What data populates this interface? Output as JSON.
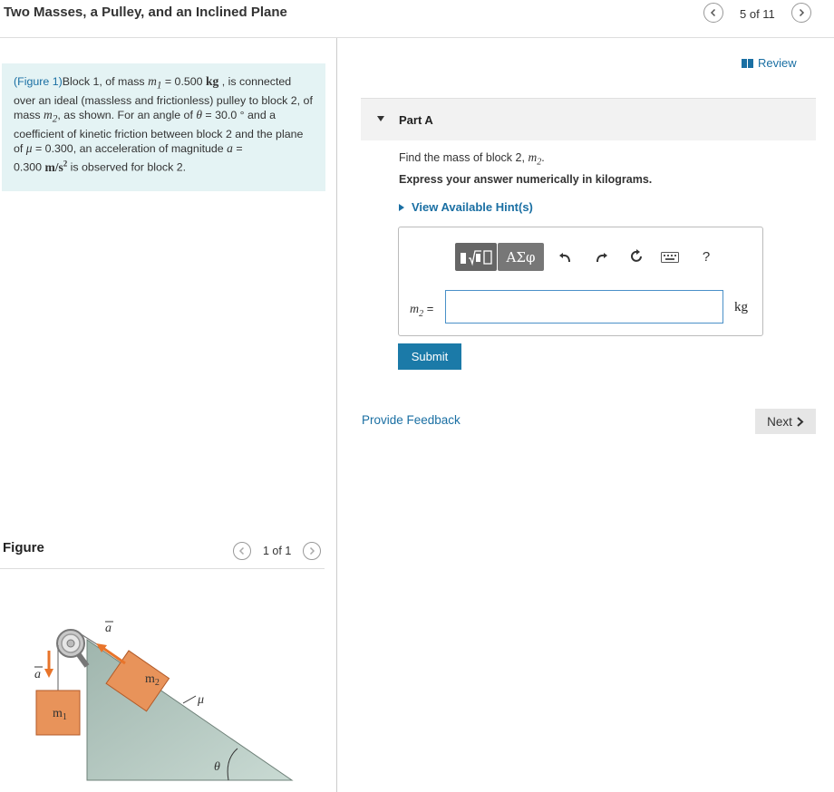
{
  "header": {
    "title": "Two Masses, a Pulley, and an Inclined Plane",
    "counter": "5 of 11"
  },
  "problem": {
    "figure_link": "(Figure 1)",
    "p1": "Block 1, of mass ",
    "m1": "m",
    "m1_sub": "1",
    "eq1": " = 0.500 ",
    "kg": "kg",
    "p2": " , is connected over an ideal (massless and frictionless) pulley to block 2, of mass ",
    "m2": "m",
    "m2_sub": "2",
    "p3": ", as shown. For an angle of ",
    "theta": "θ",
    "p4": " = 30.0 ° and a coefficient of kinetic friction between block 2 and the plane of ",
    "mu": "μ",
    "p5": " = 0.300, an acceleration of magnitude ",
    "a": "a",
    "p6": " =",
    "p7": "0.300 ",
    "accel_unit": "m/s",
    "accel_exp": "2",
    "p8": " is observed for block 2."
  },
  "figure": {
    "label": "Figure",
    "counter": "1 of 1",
    "labels": {
      "a_top": "a",
      "a_left": "a",
      "m1": "m",
      "m1_sub": "1",
      "m2": "m",
      "m2_sub": "2",
      "mu": "μ",
      "theta": "θ"
    },
    "colors": {
      "block": "#e8935a",
      "block_border": "#b25a28",
      "incline": "#b8ccc3",
      "arrow": "#e8742a"
    }
  },
  "review": {
    "label": "Review"
  },
  "part": {
    "label": "Part A",
    "question_prefix": "Find the mass of block 2, ",
    "question_var": "m",
    "question_sub": "2",
    "question_suffix": ".",
    "instruction": "Express your answer numerically in kilograms.",
    "hint_label": "View Available Hint(s)"
  },
  "answer": {
    "toolbar": {
      "templates_icon": "templates-icon",
      "greek_label": "ΑΣφ",
      "undo_icon": "undo-icon",
      "redo_icon": "redo-icon",
      "reset_icon": "reset-icon",
      "keyboard_icon": "keyboard-icon",
      "help_label": "?"
    },
    "var": "m",
    "var_sub": "2",
    "eq": " =",
    "value": "",
    "unit": "kg"
  },
  "buttons": {
    "submit": "Submit",
    "feedback": "Provide Feedback",
    "next": "Next"
  },
  "colors": {
    "accent": "#1a6fa3",
    "submit_bg": "#1b7aa8",
    "problem_bg": "#e4f3f4"
  }
}
